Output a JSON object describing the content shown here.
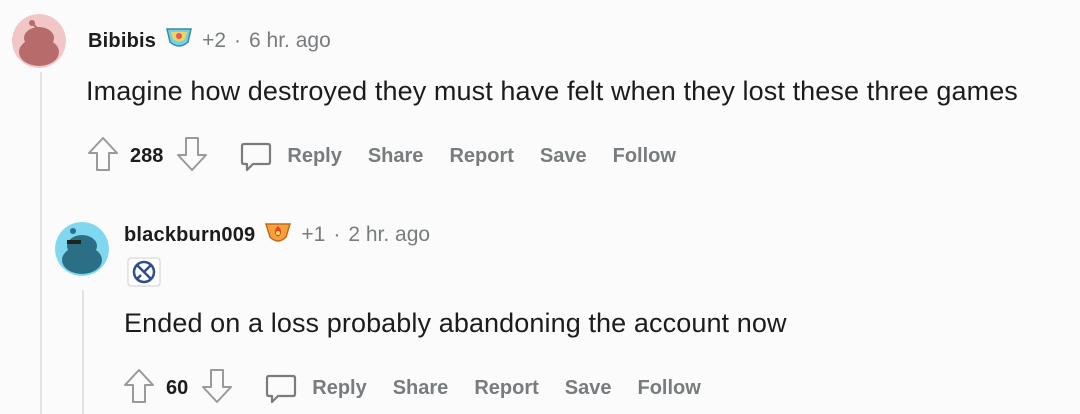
{
  "comments": [
    {
      "username": "Bibibis",
      "award_icon": "award-gift-icon",
      "award_count": "+2",
      "separator": "·",
      "timestamp": "6 hr. ago",
      "body": "Imagine how destroyed they must have felt when they lost these three games",
      "votes": "288",
      "actions": {
        "reply": "Reply",
        "share": "Share",
        "report": "Report",
        "save": "Save",
        "follow": "Follow"
      },
      "avatar_color": "#e8a6a6"
    },
    {
      "username": "blackburn009",
      "award_icon": "award-fire-icon",
      "award_count": "+1",
      "separator": "·",
      "timestamp": "2 hr. ago",
      "flair_icon": "team-flair-icon",
      "body": "Ended on a loss probably abandoning the account now",
      "votes": "60",
      "actions": {
        "reply": "Reply",
        "share": "Share",
        "report": "Report",
        "save": "Save",
        "follow": "Follow"
      },
      "avatar_color": "#5ac8e6"
    }
  ],
  "colors": {
    "muted": "#787c7e",
    "text": "#1c1c1c",
    "thread_line": "#e3e3e3"
  }
}
